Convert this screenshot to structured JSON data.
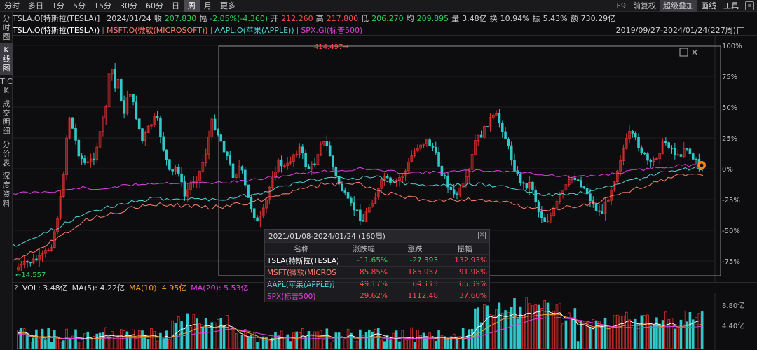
{
  "topbar": {
    "tabs": [
      "分时",
      "多日",
      "1分",
      "5分",
      "15分",
      "30分",
      "60分",
      "日",
      "周",
      "月",
      "更多"
    ],
    "active_tab": "周",
    "right_items": [
      "F9",
      "前复权",
      "超级叠加",
      "画线",
      "工具"
    ]
  },
  "sidebar": [
    "分时图",
    "K线图",
    "TICK",
    "成交明细",
    "分价表",
    "深度资料"
  ],
  "info": {
    "name": "TSLA.O[特斯拉(TESLA)]",
    "date": "2024/01/24",
    "close_label": "收",
    "close": "207.830",
    "change_label": "幅",
    "change": "-2.05%(-4.360)",
    "open_label": "开",
    "open": "212.260",
    "high_label": "高",
    "high": "217.800",
    "low_label": "低",
    "low": "206.270",
    "avg_label": "均",
    "avg": "209.895",
    "vol_label": "量",
    "vol": "3.48亿",
    "turnover_label": "换",
    "turnover": "10.94%",
    "amp_label": "振",
    "amp": "5.43%",
    "amount_label": "额",
    "amount": "730.29亿"
  },
  "legend": {
    "s1": "TSLA.O(特斯拉(TESLA))",
    "s2": "MSFT.O(微软(MICROSOFT))",
    "s3": "AAPL.O(苹果(APPLE))",
    "s4": "SPX.GI(标普500)",
    "range": "2019/09/27-2024/01/24(227周)"
  },
  "colors": {
    "tsla": "#ffffff",
    "msft": "#ff7f6e",
    "aapl": "#4fd6d6",
    "spx": "#e040e0",
    "up": "#e03030",
    "down": "#30c8c8"
  },
  "price_labels": {
    "high": "414.497",
    "low": "14.557"
  },
  "yaxis": [
    "100%",
    "75%",
    "50%",
    "25%",
    "0%",
    "-25%",
    "-50%",
    "-75%"
  ],
  "table": {
    "title": "2021/01/08-2024/01/24 (160周)",
    "headers": [
      "名称",
      "涨跌幅",
      "涨跌",
      "振幅"
    ],
    "rows": [
      {
        "name": "TSLA(特斯拉(TESLA))",
        "pct": "-11.65%",
        "chg": "-27.393",
        "amp": "132.93%"
      },
      {
        "name": "MSFT(微软(MICROS",
        "pct": "85.85%",
        "chg": "185.957",
        "amp": "91.98%"
      },
      {
        "name": "AAPL(苹果(APPLE))",
        "pct": "49.17%",
        "chg": "64.113",
        "amp": "65.39%"
      },
      {
        "name": "SPX(标普500)",
        "pct": "29.62%",
        "chg": "1112.48",
        "amp": "37.60%"
      }
    ]
  },
  "volume": {
    "vol": "VOL: 3.48亿",
    "ma5": "MA(5): 4.22亿",
    "ma10": "MA(10): 4.95亿",
    "ma20": "MA(20): 5.53亿",
    "axis": [
      "8.80亿",
      "4.40亿"
    ]
  }
}
